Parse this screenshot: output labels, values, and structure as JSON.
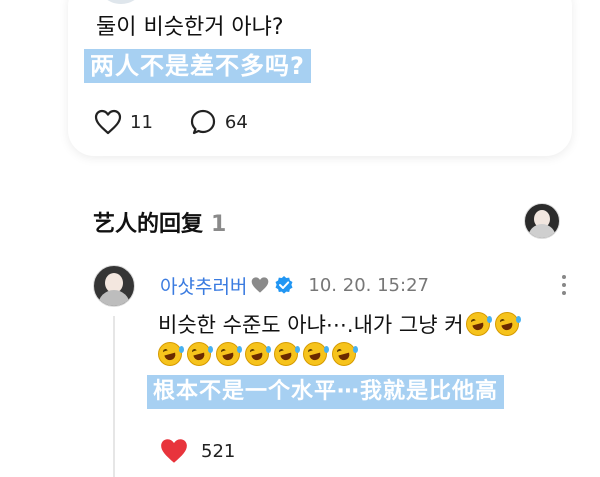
{
  "post": {
    "question_ko": "둘이 비슷한거 아냐?",
    "question_zh": "两人不是差不多吗?",
    "likes": "11",
    "comments": "64"
  },
  "section": {
    "title": "艺人的回复",
    "count": "1"
  },
  "reply": {
    "username": "아샷추러버",
    "time": "10. 20. 15:27",
    "text_ko": "비슷한 수준도 아냐⋯.내가 그냥 커",
    "emoji_line1_count": 2,
    "emoji_line2_count": 7,
    "text_zh": "根本不是一个水平⋯我就是比他高",
    "likes": "521"
  },
  "colors": {
    "highlight": "#a7d0f2",
    "username": "#3a7be0",
    "like_heart": "#e8343c",
    "verified": "#2196f3"
  },
  "icons": [
    "heart-outline-icon",
    "comment-bubble-icon",
    "gray-heart-icon",
    "verified-badge-icon",
    "more-vertical-icon",
    "rofl-emoji-icon",
    "heart-filled-icon"
  ]
}
